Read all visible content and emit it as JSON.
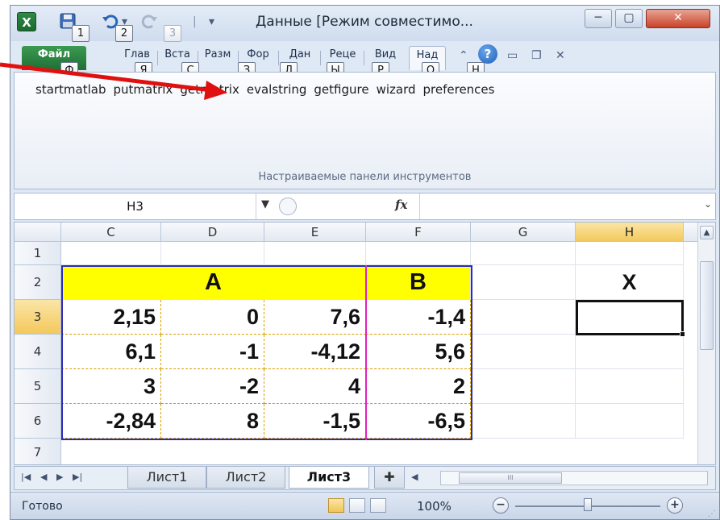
{
  "window": {
    "title": "Данные  [Режим совместимо...",
    "logo": "X",
    "minimize": "─",
    "maximize": "▢",
    "close": "✕"
  },
  "quick_access_keytips": [
    "1",
    "2",
    "3"
  ],
  "ribbon_tabs": [
    {
      "label": "Файл",
      "keytip": "Ф"
    },
    {
      "label": "Глав",
      "keytip": "Я"
    },
    {
      "label": "Вста",
      "keytip": "С"
    },
    {
      "label": "Разм",
      "keytip": "З"
    },
    {
      "label": "Фор",
      "keytip": "Л"
    },
    {
      "label": "Дан",
      "keytip": "Ы"
    },
    {
      "label": "Реце",
      "keytip": "Р"
    },
    {
      "label": "Вид",
      "keytip": "О"
    },
    {
      "label": "Над",
      "keytip": "Н"
    }
  ],
  "ribbon": {
    "items": [
      "startmatlab",
      "putmatrix",
      "getmatrix",
      "evalstring",
      "getfigure",
      "wizard",
      "preferences"
    ],
    "group_label": "Настраиваемые панели инструментов"
  },
  "formula_bar": {
    "name_box": "H3",
    "fx": "fx",
    "value": ""
  },
  "grid": {
    "columns": [
      "C",
      "D",
      "E",
      "F",
      "G",
      "H"
    ],
    "rows": [
      "1",
      "2",
      "3",
      "4",
      "5",
      "6",
      "7"
    ],
    "header_a": "A",
    "header_b": "B",
    "header_x": "X",
    "data": [
      [
        "2,15",
        "0",
        "7,6",
        "-1,4"
      ],
      [
        "6,1",
        "-1",
        "-4,12",
        "5,6"
      ],
      [
        "3",
        "-2",
        "4",
        "2"
      ],
      [
        "-2,84",
        "8",
        "-1,5",
        "-6,5"
      ]
    ]
  },
  "sheets": {
    "tabs": [
      "Лист1",
      "Лист2",
      "Лист3"
    ],
    "active": "Лист3"
  },
  "status": {
    "text": "Готово",
    "zoom": "100%",
    "zoom_fraction": 0.5
  },
  "colors": {
    "header_fill": "#ffff00",
    "table_border": "#2b2bb8",
    "separator": "#e020c0",
    "arrow": "#e01010"
  }
}
